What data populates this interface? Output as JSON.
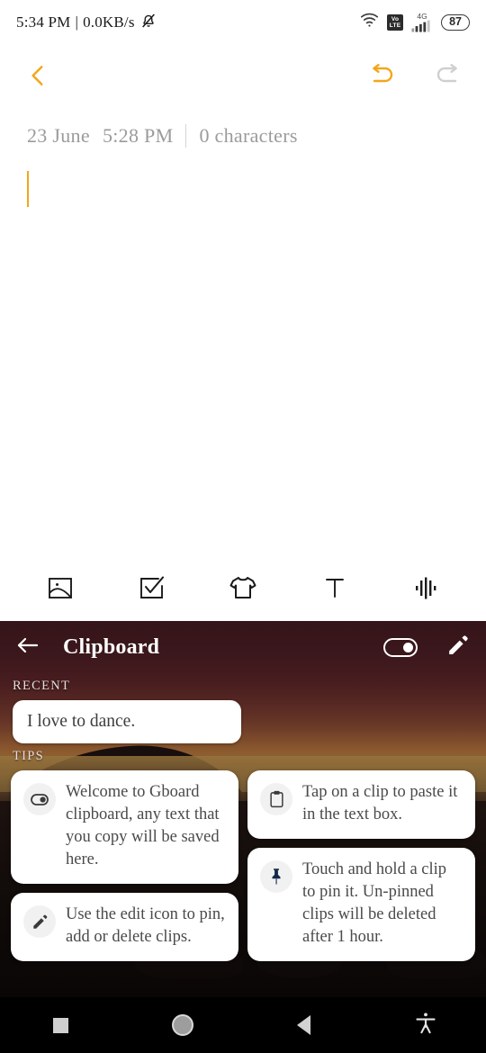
{
  "status_bar": {
    "time": "5:34 PM",
    "separator": "|",
    "network_speed": "0.0KB/s",
    "mute_icon": "bell-muted-icon",
    "wifi_icon": "wifi-icon",
    "volte_top": "Vo",
    "volte_bottom": "LTE",
    "network_type": "4G",
    "signal_icon": "signal-bars-icon",
    "battery_level": "87"
  },
  "note_app": {
    "back_icon": "chevron-left-icon",
    "undo_icon": "undo-icon",
    "redo_icon": "redo-icon",
    "accent_color": "#F2A71B",
    "inactive_color": "#c9c9c9",
    "meta": {
      "date": "23 June",
      "time": "5:28 PM",
      "character_count": "0 characters"
    },
    "editor": {
      "content": "",
      "caret_visible": true
    },
    "toolbar": [
      {
        "name": "insert-image-button",
        "icon": "image-icon"
      },
      {
        "name": "checklist-button",
        "icon": "checkbox-checked-icon"
      },
      {
        "name": "style-button",
        "icon": "tshirt-icon"
      },
      {
        "name": "text-format-button",
        "icon": "text-format-icon",
        "glyph": "T"
      },
      {
        "name": "audio-record-button",
        "icon": "waveform-icon"
      }
    ]
  },
  "clipboard": {
    "back_icon": "arrow-left-icon",
    "title": "Clipboard",
    "toggle": {
      "name": "clipboard-toggle",
      "state": "on"
    },
    "edit_icon": "pencil-icon",
    "recent_label": "RECENT",
    "recent_clips": [
      {
        "text": "I love to dance."
      }
    ],
    "tips_label": "TIPS",
    "tips": [
      {
        "icon": "toggle-icon",
        "text": "Welcome to Gboard clipboard, any text that you copy will be saved here.",
        "column": "left"
      },
      {
        "icon": "clipboard-icon",
        "text": "Tap on a clip to paste it in the text box.",
        "column": "right"
      },
      {
        "icon": "pencil-icon",
        "text": "Use the edit icon to pin, add or delete clips.",
        "column": "left"
      },
      {
        "icon": "pin-icon",
        "text": "Touch and hold a clip to pin it. Un-pinned clips will be deleted after 1 hour.",
        "column": "right"
      }
    ]
  },
  "nav_bar": {
    "recents": {
      "name": "recents-button",
      "icon": "square-icon"
    },
    "home": {
      "name": "home-button",
      "icon": "circle-icon"
    },
    "back": {
      "name": "back-button",
      "icon": "triangle-left-icon"
    },
    "accessibility": {
      "name": "accessibility-button",
      "icon": "accessibility-icon"
    }
  }
}
